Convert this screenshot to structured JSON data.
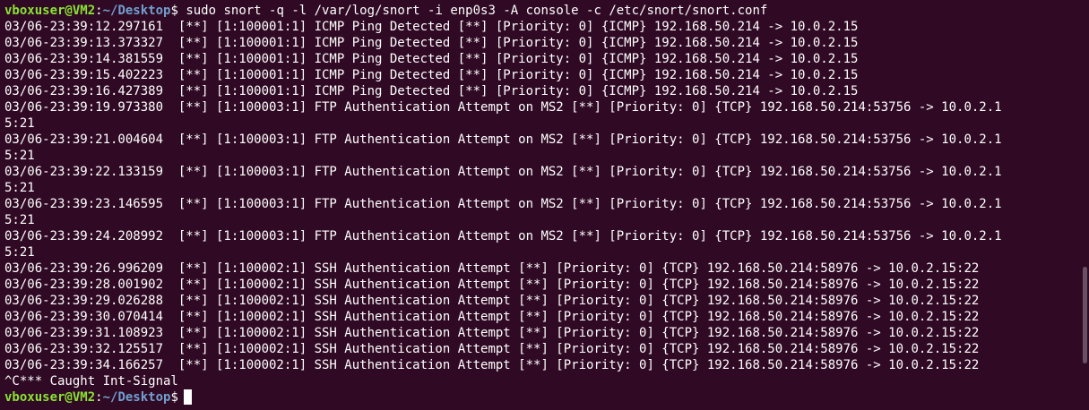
{
  "prompt": {
    "user_host": "vboxuser@VM2",
    "separator": ":",
    "path": "~/Desktop",
    "symbol": "$"
  },
  "command": " sudo snort -q -l /var/log/snort -i enp0s3 -A console -c /etc/snort/snort.conf",
  "output_lines": [
    "03/06-23:39:12.297161  [**] [1:100001:1] ICMP Ping Detected [**] [Priority: 0] {ICMP} 192.168.50.214 -> 10.0.2.15",
    "03/06-23:39:13.373327  [**] [1:100001:1] ICMP Ping Detected [**] [Priority: 0] {ICMP} 192.168.50.214 -> 10.0.2.15",
    "03/06-23:39:14.381559  [**] [1:100001:1] ICMP Ping Detected [**] [Priority: 0] {ICMP} 192.168.50.214 -> 10.0.2.15",
    "03/06-23:39:15.402223  [**] [1:100001:1] ICMP Ping Detected [**] [Priority: 0] {ICMP} 192.168.50.214 -> 10.0.2.15",
    "03/06-23:39:16.427389  [**] [1:100001:1] ICMP Ping Detected [**] [Priority: 0] {ICMP} 192.168.50.214 -> 10.0.2.15",
    "03/06-23:39:19.973380  [**] [1:100003:1] FTP Authentication Attempt on MS2 [**] [Priority: 0] {TCP} 192.168.50.214:53756 -> 10.0.2.1",
    "5:21",
    "03/06-23:39:21.004604  [**] [1:100003:1] FTP Authentication Attempt on MS2 [**] [Priority: 0] {TCP} 192.168.50.214:53756 -> 10.0.2.1",
    "5:21",
    "03/06-23:39:22.133159  [**] [1:100003:1] FTP Authentication Attempt on MS2 [**] [Priority: 0] {TCP} 192.168.50.214:53756 -> 10.0.2.1",
    "5:21",
    "03/06-23:39:23.146595  [**] [1:100003:1] FTP Authentication Attempt on MS2 [**] [Priority: 0] {TCP} 192.168.50.214:53756 -> 10.0.2.1",
    "5:21",
    "03/06-23:39:24.208992  [**] [1:100003:1] FTP Authentication Attempt on MS2 [**] [Priority: 0] {TCP} 192.168.50.214:53756 -> 10.0.2.1",
    "5:21",
    "03/06-23:39:26.996209  [**] [1:100002:1] SSH Authentication Attempt [**] [Priority: 0] {TCP} 192.168.50.214:58976 -> 10.0.2.15:22",
    "03/06-23:39:28.001902  [**] [1:100002:1] SSH Authentication Attempt [**] [Priority: 0] {TCP} 192.168.50.214:58976 -> 10.0.2.15:22",
    "03/06-23:39:29.026288  [**] [1:100002:1] SSH Authentication Attempt [**] [Priority: 0] {TCP} 192.168.50.214:58976 -> 10.0.2.15:22",
    "03/06-23:39:30.070414  [**] [1:100002:1] SSH Authentication Attempt [**] [Priority: 0] {TCP} 192.168.50.214:58976 -> 10.0.2.15:22",
    "03/06-23:39:31.108923  [**] [1:100002:1] SSH Authentication Attempt [**] [Priority: 0] {TCP} 192.168.50.214:58976 -> 10.0.2.15:22",
    "03/06-23:39:32.125517  [**] [1:100002:1] SSH Authentication Attempt [**] [Priority: 0] {TCP} 192.168.50.214:58976 -> 10.0.2.15:22",
    "03/06-23:39:34.166257  [**] [1:100002:1] SSH Authentication Attempt [**] [Priority: 0] {TCP} 192.168.50.214:58976 -> 10.0.2.15:22",
    "^C*** Caught Int-Signal"
  ],
  "colors": {
    "background": "#300a24",
    "text": "#ffffff",
    "prompt_user": "#8ae234",
    "prompt_path": "#729fcf"
  }
}
